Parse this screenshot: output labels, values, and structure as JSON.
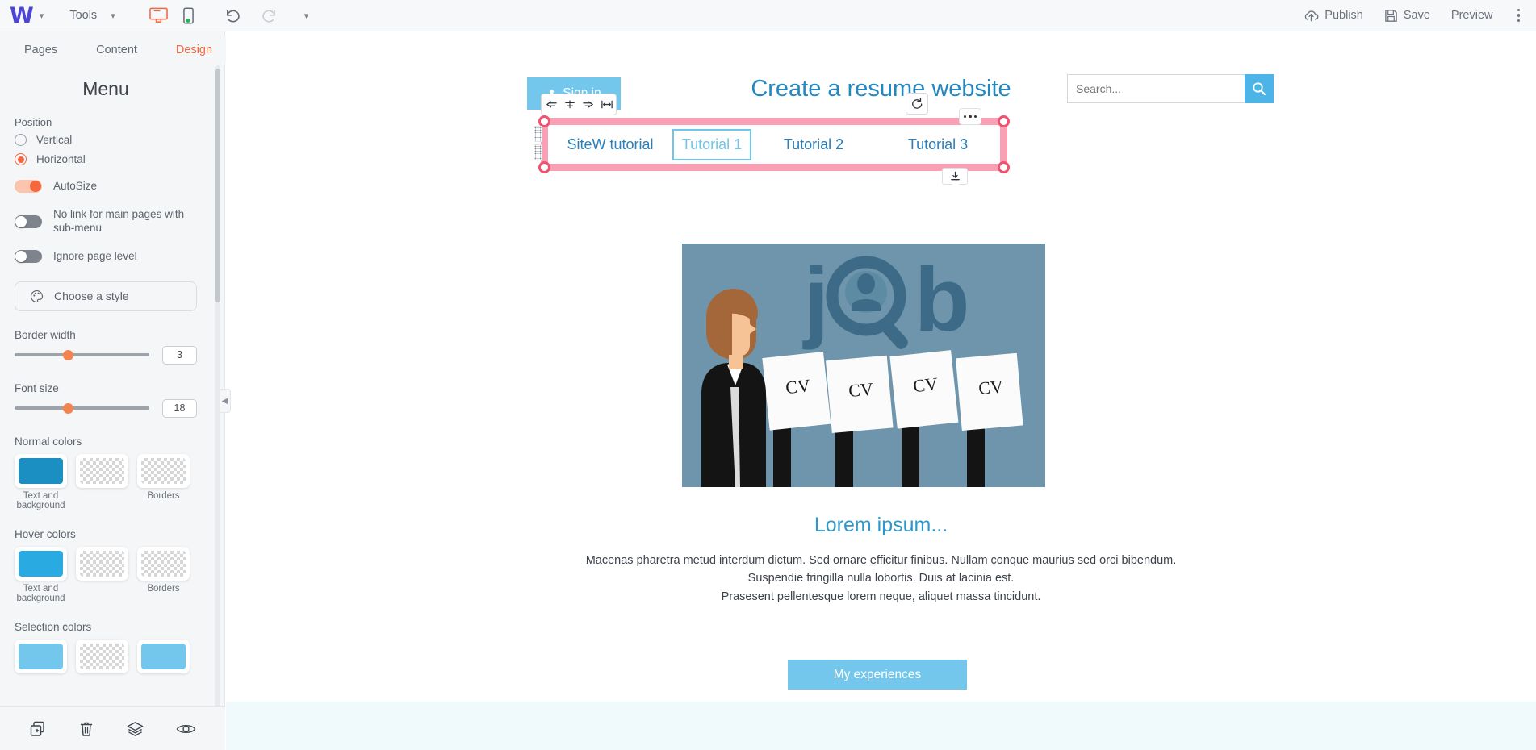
{
  "topbar": {
    "logo": "W",
    "tools_label": "Tools",
    "desktop_icon": "desktop-monitor-icon",
    "mobile_icon": "mobile-phone-icon",
    "undo_icon": "undo-arrow-icon",
    "redo_icon": "redo-arrow-icon",
    "more_chevron": "chevron-down-icon",
    "publish_label": "Publish",
    "save_label": "Save",
    "preview_label": "Preview"
  },
  "sidebar": {
    "tabs": [
      {
        "label": "Pages",
        "active": false
      },
      {
        "label": "Content",
        "active": false
      },
      {
        "label": "Design",
        "active": true
      }
    ],
    "panel_title": "Menu",
    "position": {
      "label": "Position",
      "options": [
        {
          "label": "Vertical",
          "selected": false
        },
        {
          "label": "Horizontal",
          "selected": true
        }
      ]
    },
    "toggles": [
      {
        "label": "AutoSize",
        "on": true
      },
      {
        "label": "No link for main pages with sub-menu",
        "on": false
      },
      {
        "label": "Ignore page level",
        "on": false
      }
    ],
    "style_button": {
      "label": "Choose a style",
      "icon": "palette-icon"
    },
    "sliders": [
      {
        "label": "Border width",
        "value": "3"
      },
      {
        "label": "Font size",
        "value": "18"
      }
    ],
    "color_groups": [
      {
        "label": "Normal colors",
        "swatches": [
          {
            "caption": "Text and background",
            "color": "#1b8ec2",
            "transparent": false
          },
          {
            "caption": "",
            "color": "",
            "transparent": true
          },
          {
            "caption": "Borders",
            "color": "",
            "transparent": true
          }
        ]
      },
      {
        "label": "Hover colors",
        "swatches": [
          {
            "caption": "Text and background",
            "color": "#29abe2",
            "transparent": false
          },
          {
            "caption": "",
            "color": "",
            "transparent": true
          },
          {
            "caption": "Borders",
            "color": "",
            "transparent": true
          }
        ]
      },
      {
        "label": "Selection colors",
        "swatches": [
          {
            "caption": "",
            "color": "#74c7ec",
            "transparent": false
          },
          {
            "caption": "",
            "color": "",
            "transparent": true
          },
          {
            "caption": "",
            "color": "#74c7ec",
            "transparent": false
          }
        ]
      }
    ],
    "bottom_actions": [
      {
        "icon": "duplicate-icon"
      },
      {
        "icon": "trash-icon"
      },
      {
        "icon": "layers-icon"
      },
      {
        "icon": "eye-icon"
      }
    ]
  },
  "canvas": {
    "signin_button": {
      "label": "Sign in",
      "icon": "user-icon"
    },
    "page_title": "Create a resume website",
    "search": {
      "placeholder": "Search...",
      "icon": "search-icon"
    },
    "align_toolbar": [
      {
        "icon": "align-left-icon"
      },
      {
        "icon": "align-center-icon"
      },
      {
        "icon": "align-right-icon"
      },
      {
        "icon": "stretch-width-icon"
      }
    ],
    "reload_button": {
      "icon": "reload-icon"
    },
    "selected_widget": {
      "options_icon": "more-options-icon",
      "anchor_icon": "anchor-bottom-icon",
      "items": [
        {
          "label": "SiteW tutorial",
          "selected": false
        },
        {
          "label": "Tutorial 1",
          "selected": true
        },
        {
          "label": "Tutorial 2",
          "selected": false
        },
        {
          "label": "Tutorial 3",
          "selected": false
        }
      ]
    },
    "illustration": {
      "word": "job",
      "paper_label": "CV",
      "background": "#6e95ab"
    },
    "lorem_title": "Lorem ipsum...",
    "lorem_line1": "Macenas pharetra metud interdum dictum. Sed ornare efficitur finibus. Nullam conque maurius sed orci bibendum.",
    "lorem_line2": "Suspendie fringilla nulla lobortis. Duis at lacinia est.",
    "lorem_line3": "Prasesent pellentesque lorem neque, aliquet massa tincidunt.",
    "experiences_button": "My experiences"
  }
}
